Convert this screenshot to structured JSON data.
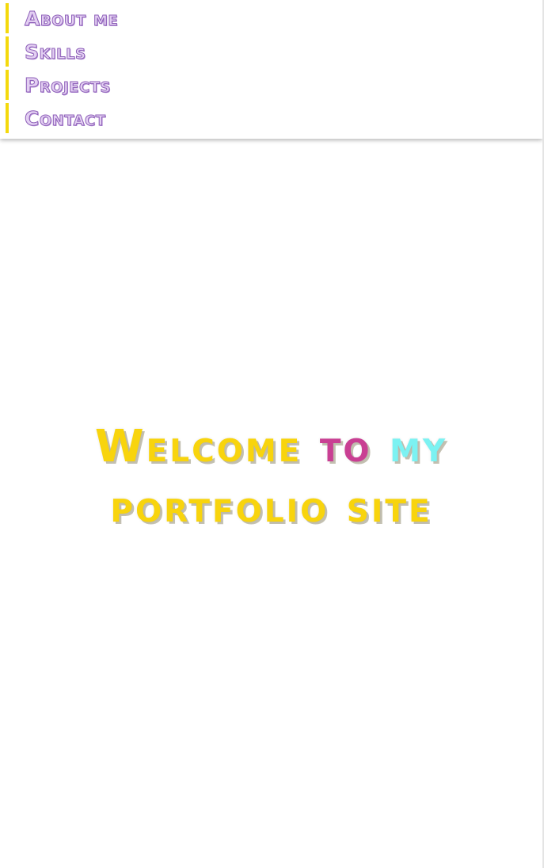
{
  "nav": {
    "items": [
      {
        "label": "About me"
      },
      {
        "label": "Skills"
      },
      {
        "label": "Projects"
      },
      {
        "label": "Contact"
      }
    ]
  },
  "hero": {
    "line1": {
      "part1": "Welcome",
      "part2": "to",
      "part3": "my"
    },
    "line2": {
      "text": "portfolio site"
    }
  },
  "colors": {
    "accent_bar": "#f4d90c",
    "nav_text": "#e3cff2",
    "nav_outline": "#8d5fb8",
    "hero_yellow": "#f8d40d",
    "hero_magenta": "#c93f93",
    "hero_cyan": "#7cf2f2"
  }
}
